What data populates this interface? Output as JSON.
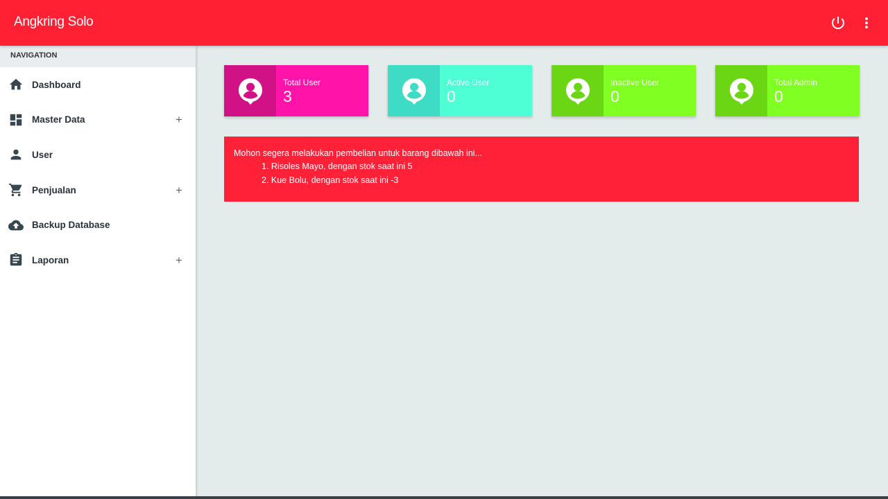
{
  "app": {
    "title": "Angkring Solo"
  },
  "sidebar": {
    "header": "NAVIGATION",
    "items": [
      {
        "label": "Dashboard",
        "icon": "home-icon",
        "expandable": false
      },
      {
        "label": "Master Data",
        "icon": "dashboard-grid-icon",
        "expandable": true
      },
      {
        "label": "User",
        "icon": "person-icon",
        "expandable": false
      },
      {
        "label": "Penjualan",
        "icon": "cart-icon",
        "expandable": true
      },
      {
        "label": "Backup Database",
        "icon": "cloud-upload-icon",
        "expandable": false
      },
      {
        "label": "Laporan",
        "icon": "clipboard-icon",
        "expandable": true
      }
    ],
    "expand_symbol": "+"
  },
  "stats": [
    {
      "title": "Total User",
      "count": "3",
      "color": "#ff13a8",
      "dark": "#d01286"
    },
    {
      "title": "Active User",
      "count": "0",
      "color": "#4effd6",
      "dark": "#3edcc4"
    },
    {
      "title": "Inactive User",
      "count": "0",
      "color": "#80ff22",
      "dark": "#6ad614"
    },
    {
      "title": "Total Admin",
      "count": "0",
      "color": "#80ff22",
      "dark": "#6ad614"
    }
  ],
  "alert": {
    "message": "Mohon segera melakukan pembelian untuk barang dibawah ini...",
    "items": [
      "1. Risoles Mayo, dengan stok saat ini 5",
      "2. Kue Bolu, dengan stok saat ini -3"
    ]
  },
  "colors": {
    "primary": "#ff2033",
    "background": "#e4ebeb"
  }
}
